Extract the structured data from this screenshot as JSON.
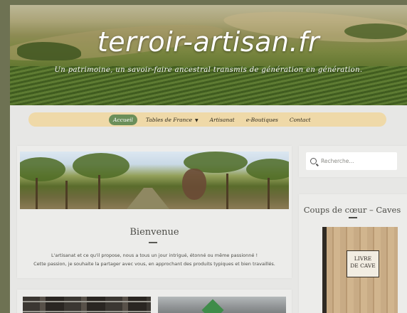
{
  "header": {
    "site_title": "terroir-artisan.fr",
    "tagline": "Un patrimoine, un savoir-faire ancestral transmis de génération en génération."
  },
  "nav": {
    "items": [
      {
        "label": "Accueil",
        "active": true
      },
      {
        "label": "Tables de France",
        "has_dropdown": true
      },
      {
        "label": "Artisanat"
      },
      {
        "label": "e-Boutiques"
      },
      {
        "label": "Contact"
      }
    ],
    "dropdown_symbol": "▼"
  },
  "main": {
    "welcome_title": "Bienvenue",
    "welcome_lines": [
      "L'artisanat et ce qu'il propose, nous a tous un jour intrigué, étonné ou même passionné !",
      "Cette passion, je souhaite la partager avec vous, en approchant des produits typiques et bien travaillés."
    ]
  },
  "sidebar": {
    "search_placeholder": "Recherche...",
    "widget_title": "Coups de cœur – Caves",
    "book_label_lines": [
      "LIVRE",
      "DE CAVE"
    ]
  },
  "colors": {
    "nav_bg": "#efd9a8",
    "nav_active": "#6b8f5a",
    "page_bg": "#e7e7e5",
    "outer_bg": "#6e7253"
  }
}
